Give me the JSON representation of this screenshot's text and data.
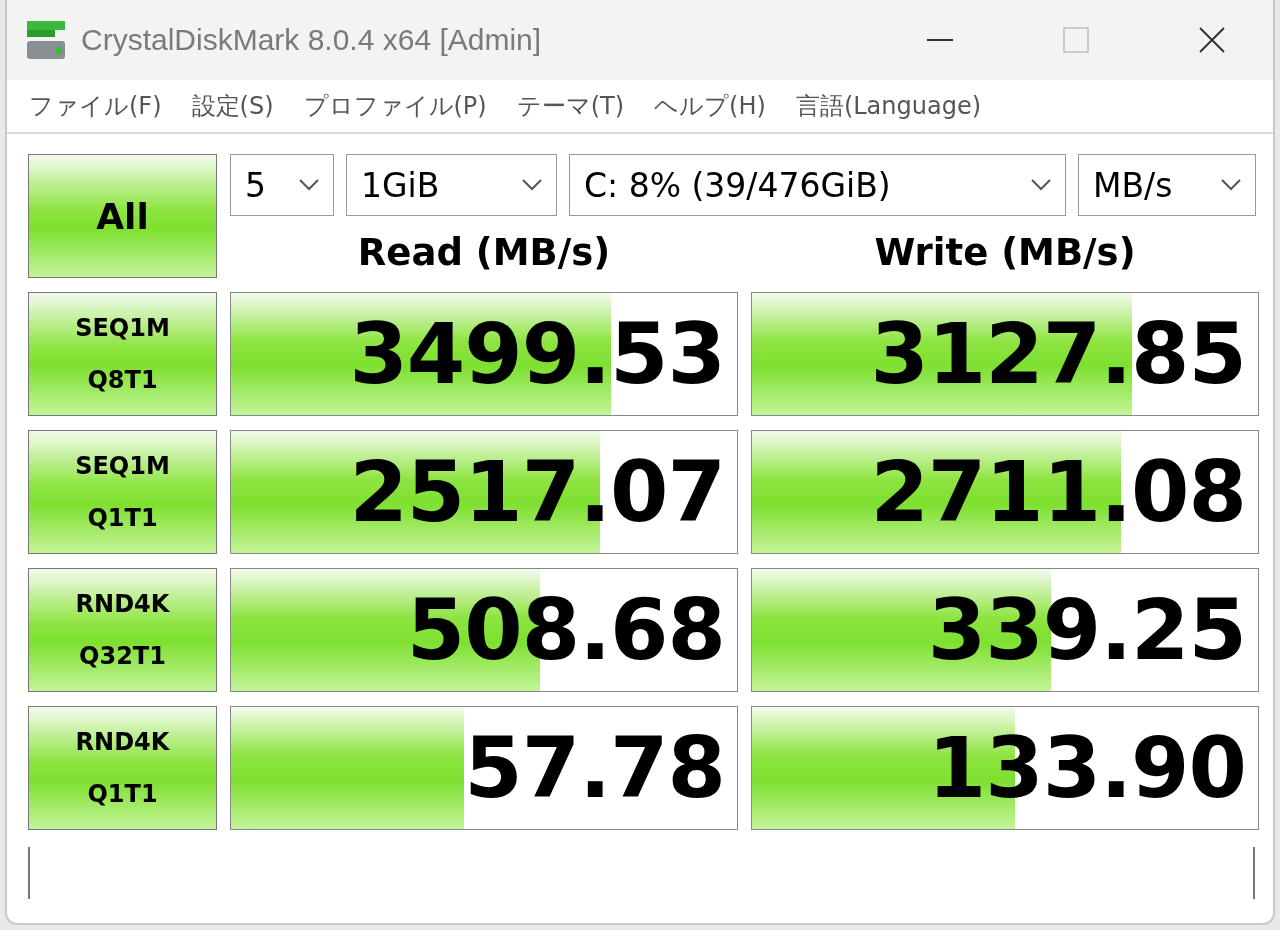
{
  "window": {
    "title": "CrystalDiskMark 8.0.4 x64 [Admin]"
  },
  "menu": [
    "ファイル(F)",
    "設定(S)",
    "プロファイル(P)",
    "テーマ(T)",
    "ヘルプ(H)",
    "言語(Language)"
  ],
  "all_button": "All",
  "selectors": [
    {
      "value": "5"
    },
    {
      "value": "1GiB"
    },
    {
      "value": "C: 8% (39/476GiB)"
    },
    {
      "value": "MB/s"
    }
  ],
  "headers": [
    "Read (MB/s)",
    "Write (MB/s)"
  ],
  "rows": [
    {
      "label": [
        "SEQ1M",
        "Q8T1"
      ],
      "read": {
        "value": "3499.53",
        "level": 0.75
      },
      "write": {
        "value": "3127.85",
        "level": 0.75
      }
    },
    {
      "label": [
        "SEQ1M",
        "Q1T1"
      ],
      "read": {
        "value": "2517.07",
        "level": 0.73
      },
      "write": {
        "value": "2711.08",
        "level": 0.73
      }
    },
    {
      "label": [
        "RND4K",
        "Q32T1"
      ],
      "read": {
        "value": "508.68",
        "level": 0.61
      },
      "write": {
        "value": "339.25",
        "level": 0.59
      }
    },
    {
      "label": [
        "RND4K",
        "Q1T1"
      ],
      "read": {
        "value": "57.78",
        "level": 0.46
      },
      "write": {
        "value": "133.90",
        "level": 0.52
      }
    }
  ]
}
